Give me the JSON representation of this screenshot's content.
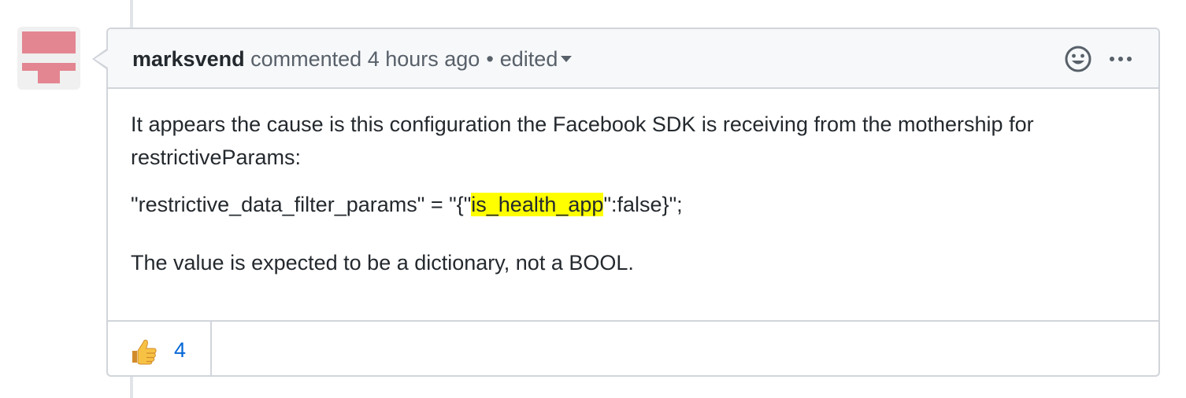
{
  "comment": {
    "author": "marksvend",
    "action": "commented",
    "time": "4 hours ago",
    "separator": "•",
    "edited_label": "edited",
    "body": {
      "p1": "It appears the cause is this configuration the Facebook SDK is receiving from the mothership for restrictiveParams:",
      "code_before": "\"restrictive_data_filter_params\" = \"{\"",
      "code_highlight": "is_health_app",
      "code_after": "\":false}\";",
      "p3": "The value is expected to be a dictionary, not a BOOL."
    },
    "reactions": [
      {
        "emoji": "thumbs-up",
        "count": "4"
      }
    ]
  },
  "colors": {
    "avatar": "#e38691",
    "highlight": "#ffff00",
    "link": "#0366d6",
    "border": "#d1d5da",
    "header_bg": "#f6f8fa"
  }
}
